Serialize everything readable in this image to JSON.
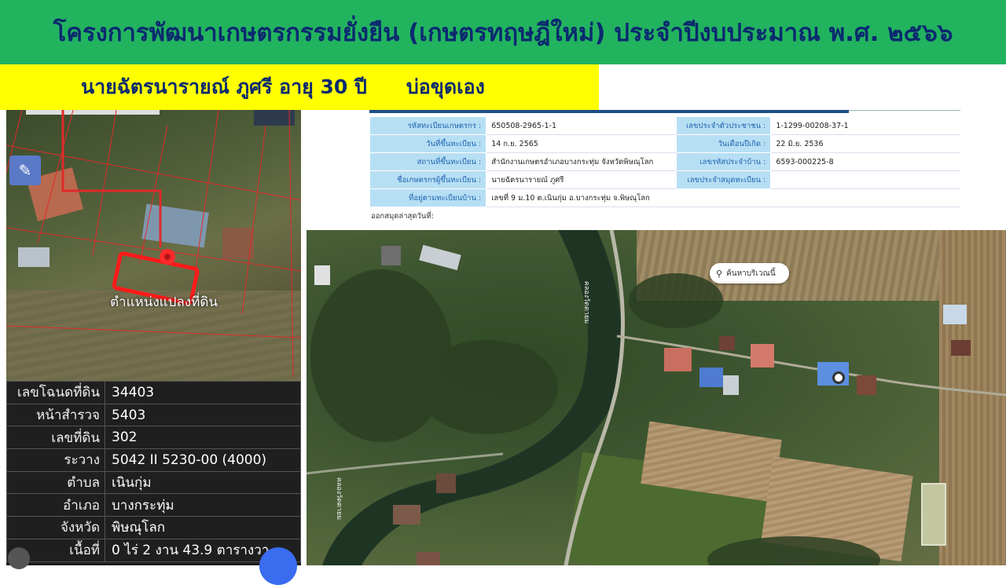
{
  "banner": {
    "title": "โครงการพัฒนาเกษตรกรรมยั่งยืน (เกษตรทฤษฎีใหม่) ประจำปีงบประมาณ พ.ศ. ๒๕๖๖"
  },
  "farmer": {
    "name_age": "นายฉัตรนารายณ์  ภูศรี อายุ 30 ปี",
    "well_type": "บ่อขุดเอง"
  },
  "left_map": {
    "parcel_label": "ตำแหน่งแปลงที่ดิน",
    "tool_icon": "ruler-pencil-icon"
  },
  "land_info": {
    "rows": [
      {
        "label": "เลขโฉนดที่ดิน",
        "value": "34403"
      },
      {
        "label": "หน้าสำรวจ",
        "value": "5403"
      },
      {
        "label": "เลขที่ดิน",
        "value": "302"
      },
      {
        "label": "ระวาง",
        "value": "5042 II 5230-00 (4000)"
      },
      {
        "label": "ตำบล",
        "value": "เนินกุ่ม"
      },
      {
        "label": "อำเภอ",
        "value": "บางกระทุ่ม"
      },
      {
        "label": "จังหวัด",
        "value": "พิษณุโลก"
      },
      {
        "label": "เนื้อที่",
        "value": "0 ไร่ 2 งาน 43.9 ตารางวา"
      }
    ]
  },
  "registration": {
    "rows": [
      {
        "k1": "รหัสทะเบียนเกษตรกร :",
        "v1": "650508-2965-1-1",
        "k2": "เลขประจำตัวประชาชน :",
        "v2": "1-1299-00208-37-1"
      },
      {
        "k1": "วันที่ขึ้นทะเบียน :",
        "v1": "14 ก.ย. 2565",
        "k2": "วันเดือนปีเกิด :",
        "v2": "22 มิ.ย. 2536"
      },
      {
        "k1": "สถานที่ขึ้นทะเบียน :",
        "v1": "สำนักงานเกษตรอำเภอบางกระทุ่ม จังหวัดพิษณุโลก",
        "k2": "เลขรหัสประจำบ้าน :",
        "v2": "6593-000225-8"
      },
      {
        "k1": "ชื่อเกษตรกรผู้ขึ้นทะเบียน :",
        "v1": "นายฉัตรนารายณ์ ภูศรี",
        "k2": "เลขประจำสมุดทะเบียน :",
        "v2": ""
      }
    ],
    "address_label": "ที่อยู่ตามทะเบียนบ้าน :",
    "address_value": "เลขที่ 9 ม.10 ต.เนินกุ่ม อ.บางกระทุ่ม จ.พิษณุโลก",
    "printed_label": "ออกสมุดล่าสุดวันที่:"
  },
  "satellite": {
    "search_label": "ค้นหาบริเวณนี้",
    "canal_label_1": "คลองวัดตายม",
    "canal_label_2": "คลองวัดตายม"
  }
}
